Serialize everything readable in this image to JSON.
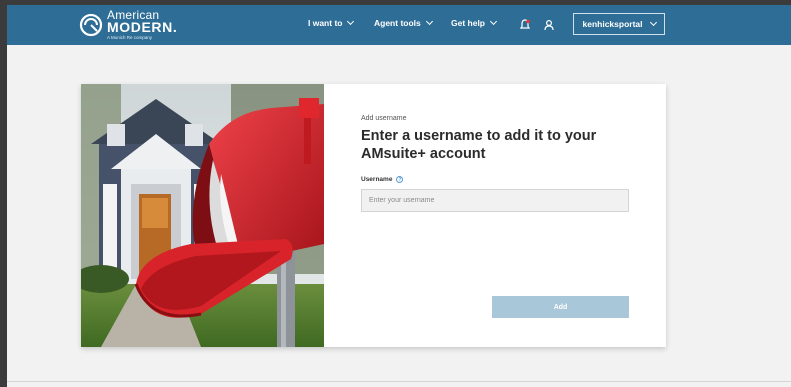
{
  "brand": {
    "line1": "American",
    "line2": "MODERN.",
    "tagline": "A Munich Re company"
  },
  "nav": {
    "items": [
      {
        "label": "I want to"
      },
      {
        "label": "Agent tools"
      },
      {
        "label": "Get help"
      }
    ],
    "user_label": "kenhicksportal"
  },
  "form": {
    "eyebrow": "Add username",
    "heading": "Enter a username to add it to your AMsuite+ account",
    "field_label": "Username",
    "placeholder": "Enter your username",
    "submit_label": "Add"
  },
  "colors": {
    "nav_bg": "#2e6e96",
    "button_disabled": "#a8c8d9",
    "mailbox_red": "#d8232a"
  }
}
